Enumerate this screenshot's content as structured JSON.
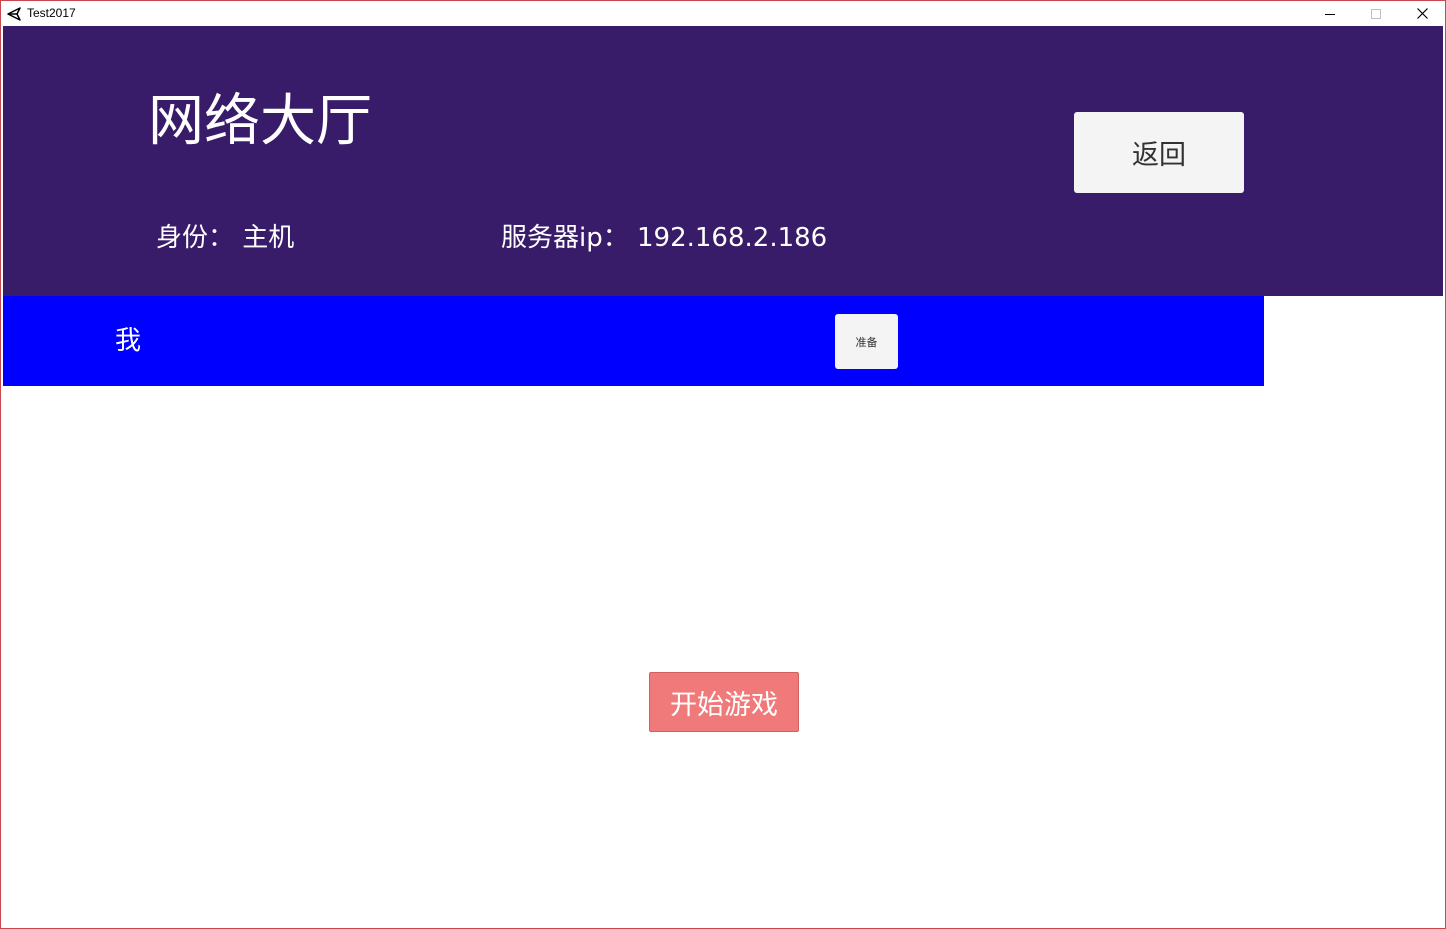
{
  "window": {
    "title": "Test2017",
    "icon": "unity-icon",
    "controls": [
      "minimize-icon",
      "maximize-icon",
      "close-icon"
    ]
  },
  "header": {
    "title": "网络大厅",
    "identity": "身份：  主机",
    "server_ip": "服务器ip：  192.168.2.186",
    "back_label": "返回",
    "background_color": "#381c6a"
  },
  "players": {
    "rows": [
      {
        "name": "我",
        "ready_label": "准备",
        "row_color": "#0000ff"
      }
    ]
  },
  "actions": {
    "start_label": "开始游戏",
    "start_color": "#f07a7a"
  }
}
